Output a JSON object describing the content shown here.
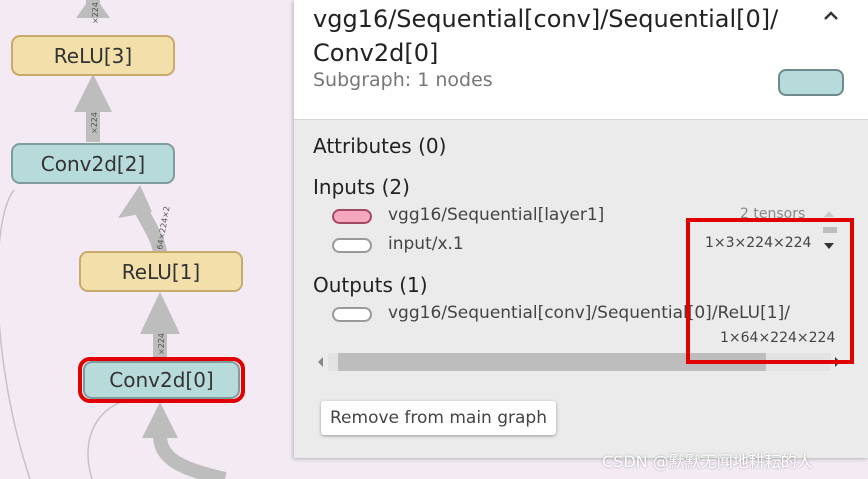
{
  "graph": {
    "nodes": [
      {
        "label": "ReLU[3]",
        "kind": "relu"
      },
      {
        "label": "Conv2d[2]",
        "kind": "conv"
      },
      {
        "label": "ReLU[1]",
        "kind": "relu"
      },
      {
        "label": "Conv2d[0]",
        "kind": "conv",
        "selected": true
      }
    ],
    "edge_labels": [
      "×224",
      "×224",
      "64×224×2",
      "×224"
    ],
    "colors": {
      "relu_fill": "#f3dfaa",
      "conv_fill": "#b7dada",
      "edge": "#bdbdbd",
      "highlight": "#e00000"
    }
  },
  "card": {
    "title": "vgg16/Sequential[conv]/Sequential[0]/ Conv2d[0]",
    "subgraph": "Subgraph: 1 nodes",
    "collapse_icon": "chevron-up-icon",
    "attributes_heading": "Attributes (0)",
    "inputs_heading": "Inputs (2)",
    "inputs": [
      {
        "name": "vgg16/Sequential[layer1]",
        "shape": "2 tensors",
        "pill": "pink"
      },
      {
        "name": "input/x.1",
        "shape": "1×3×224×224",
        "pill": "white"
      }
    ],
    "outputs_heading": "Outputs (1)",
    "outputs": [
      {
        "name": "vgg16/Sequential[conv]/Sequential[0]/ReLU[1]/",
        "shape": "1×64×224×224"
      }
    ],
    "remove_button": "Remove from main graph"
  },
  "watermark": "CSDN @默默无闻地耕耘的人"
}
